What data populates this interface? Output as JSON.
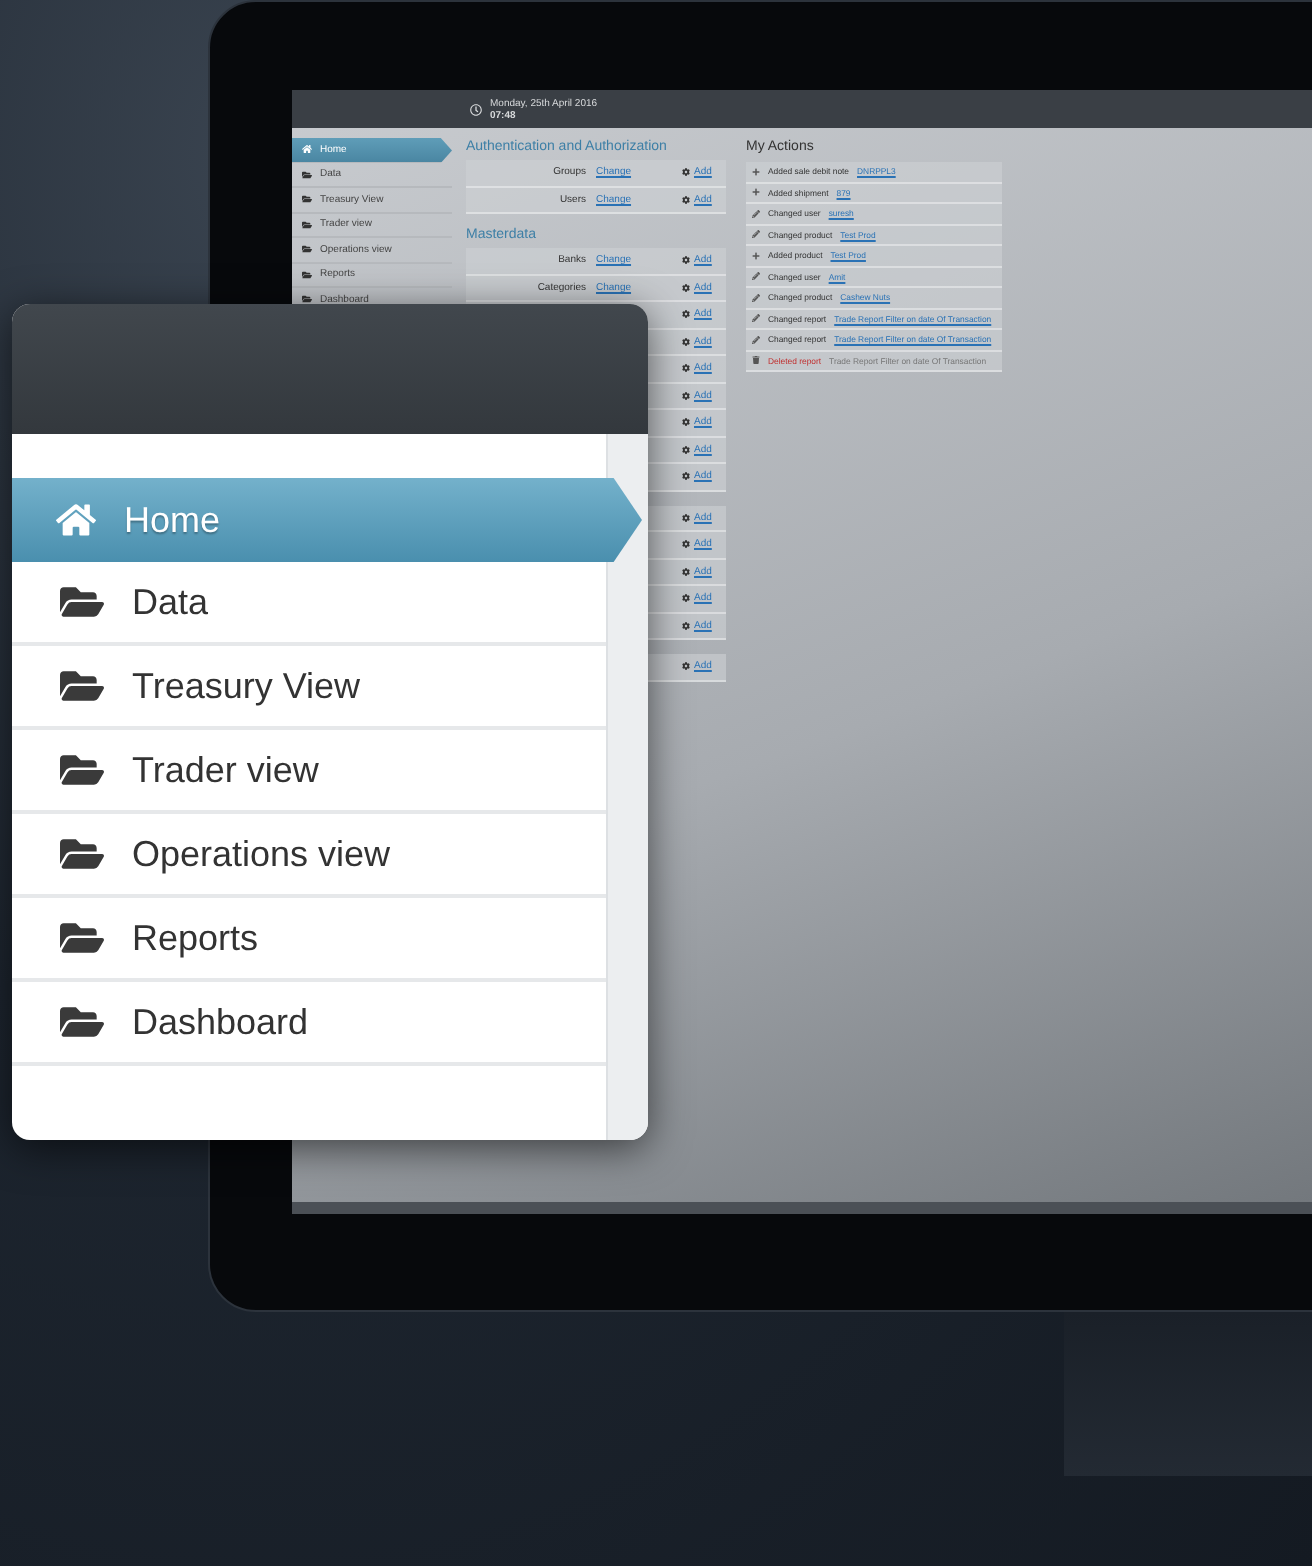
{
  "screen": {
    "clock": {
      "date": "Monday, 25th April 2016",
      "time": "07:48"
    },
    "sidebar": {
      "items": [
        {
          "label": "Home",
          "selected": true,
          "kind": "home"
        },
        {
          "label": "Data",
          "selected": false,
          "kind": "folder"
        },
        {
          "label": "Treasury View",
          "selected": false,
          "kind": "folder"
        },
        {
          "label": "Trader view",
          "selected": false,
          "kind": "folder"
        },
        {
          "label": "Operations view",
          "selected": false,
          "kind": "folder"
        },
        {
          "label": "Reports",
          "selected": false,
          "kind": "folder"
        },
        {
          "label": "Dashboard",
          "selected": false,
          "kind": "folder"
        }
      ]
    },
    "sections": [
      {
        "title": "Authentication and Authorization",
        "rows": [
          {
            "label": "Groups",
            "change": "Change",
            "add": "Add"
          },
          {
            "label": "Users",
            "change": "Change",
            "add": "Add"
          }
        ]
      },
      {
        "title": "Masterdata",
        "rows": [
          {
            "label": "Banks",
            "change": "Change",
            "add": "Add"
          },
          {
            "label": "Categories",
            "change": "Change",
            "add": "Add"
          },
          {
            "add": "Add"
          },
          {
            "add": "Add"
          },
          {
            "add": "Add"
          },
          {
            "add": "Add"
          },
          {
            "add": "Add"
          },
          {
            "add": "Add"
          },
          {
            "add": "Add"
          }
        ]
      },
      {
        "rows": [
          {
            "add": "Add"
          },
          {
            "add": "Add"
          },
          {
            "add": "Add"
          },
          {
            "add": "Add"
          },
          {
            "add": "Add"
          }
        ]
      },
      {
        "rows": [
          {
            "add": "Add"
          }
        ]
      }
    ],
    "actions": {
      "title": "My Actions",
      "items": [
        {
          "kind": "added",
          "verb": "Added sale debit note",
          "link": "DNRPPL3"
        },
        {
          "kind": "added",
          "verb": "Added shipment",
          "link": "879"
        },
        {
          "kind": "changed",
          "verb": "Changed user",
          "link": "suresh"
        },
        {
          "kind": "changed",
          "verb": "Changed product",
          "link": "Test Prod"
        },
        {
          "kind": "added",
          "verb": "Added product",
          "link": "Test Prod"
        },
        {
          "kind": "changed",
          "verb": "Changed user",
          "link": "Amit"
        },
        {
          "kind": "changed",
          "verb": "Changed product",
          "link": "Cashew Nuts"
        },
        {
          "kind": "changed",
          "verb": "Changed report",
          "link": "Trade Report Filter on date Of Transaction"
        },
        {
          "kind": "changed",
          "verb": "Changed report",
          "link": "Trade Report Filter on date Of Transaction"
        },
        {
          "kind": "deleted",
          "verb": "Deleted report",
          "text": "Trade Report Filter on date Of Transaction"
        }
      ]
    }
  },
  "callout": {
    "items": [
      {
        "label": "Home",
        "selected": true,
        "kind": "home"
      },
      {
        "label": "Data",
        "selected": false,
        "kind": "folder"
      },
      {
        "label": "Treasury View",
        "selected": false,
        "kind": "folder"
      },
      {
        "label": "Trader view",
        "selected": false,
        "kind": "folder"
      },
      {
        "label": "Operations view",
        "selected": false,
        "kind": "folder"
      },
      {
        "label": "Reports",
        "selected": false,
        "kind": "folder"
      },
      {
        "label": "Dashboard",
        "selected": false,
        "kind": "folder"
      }
    ]
  }
}
